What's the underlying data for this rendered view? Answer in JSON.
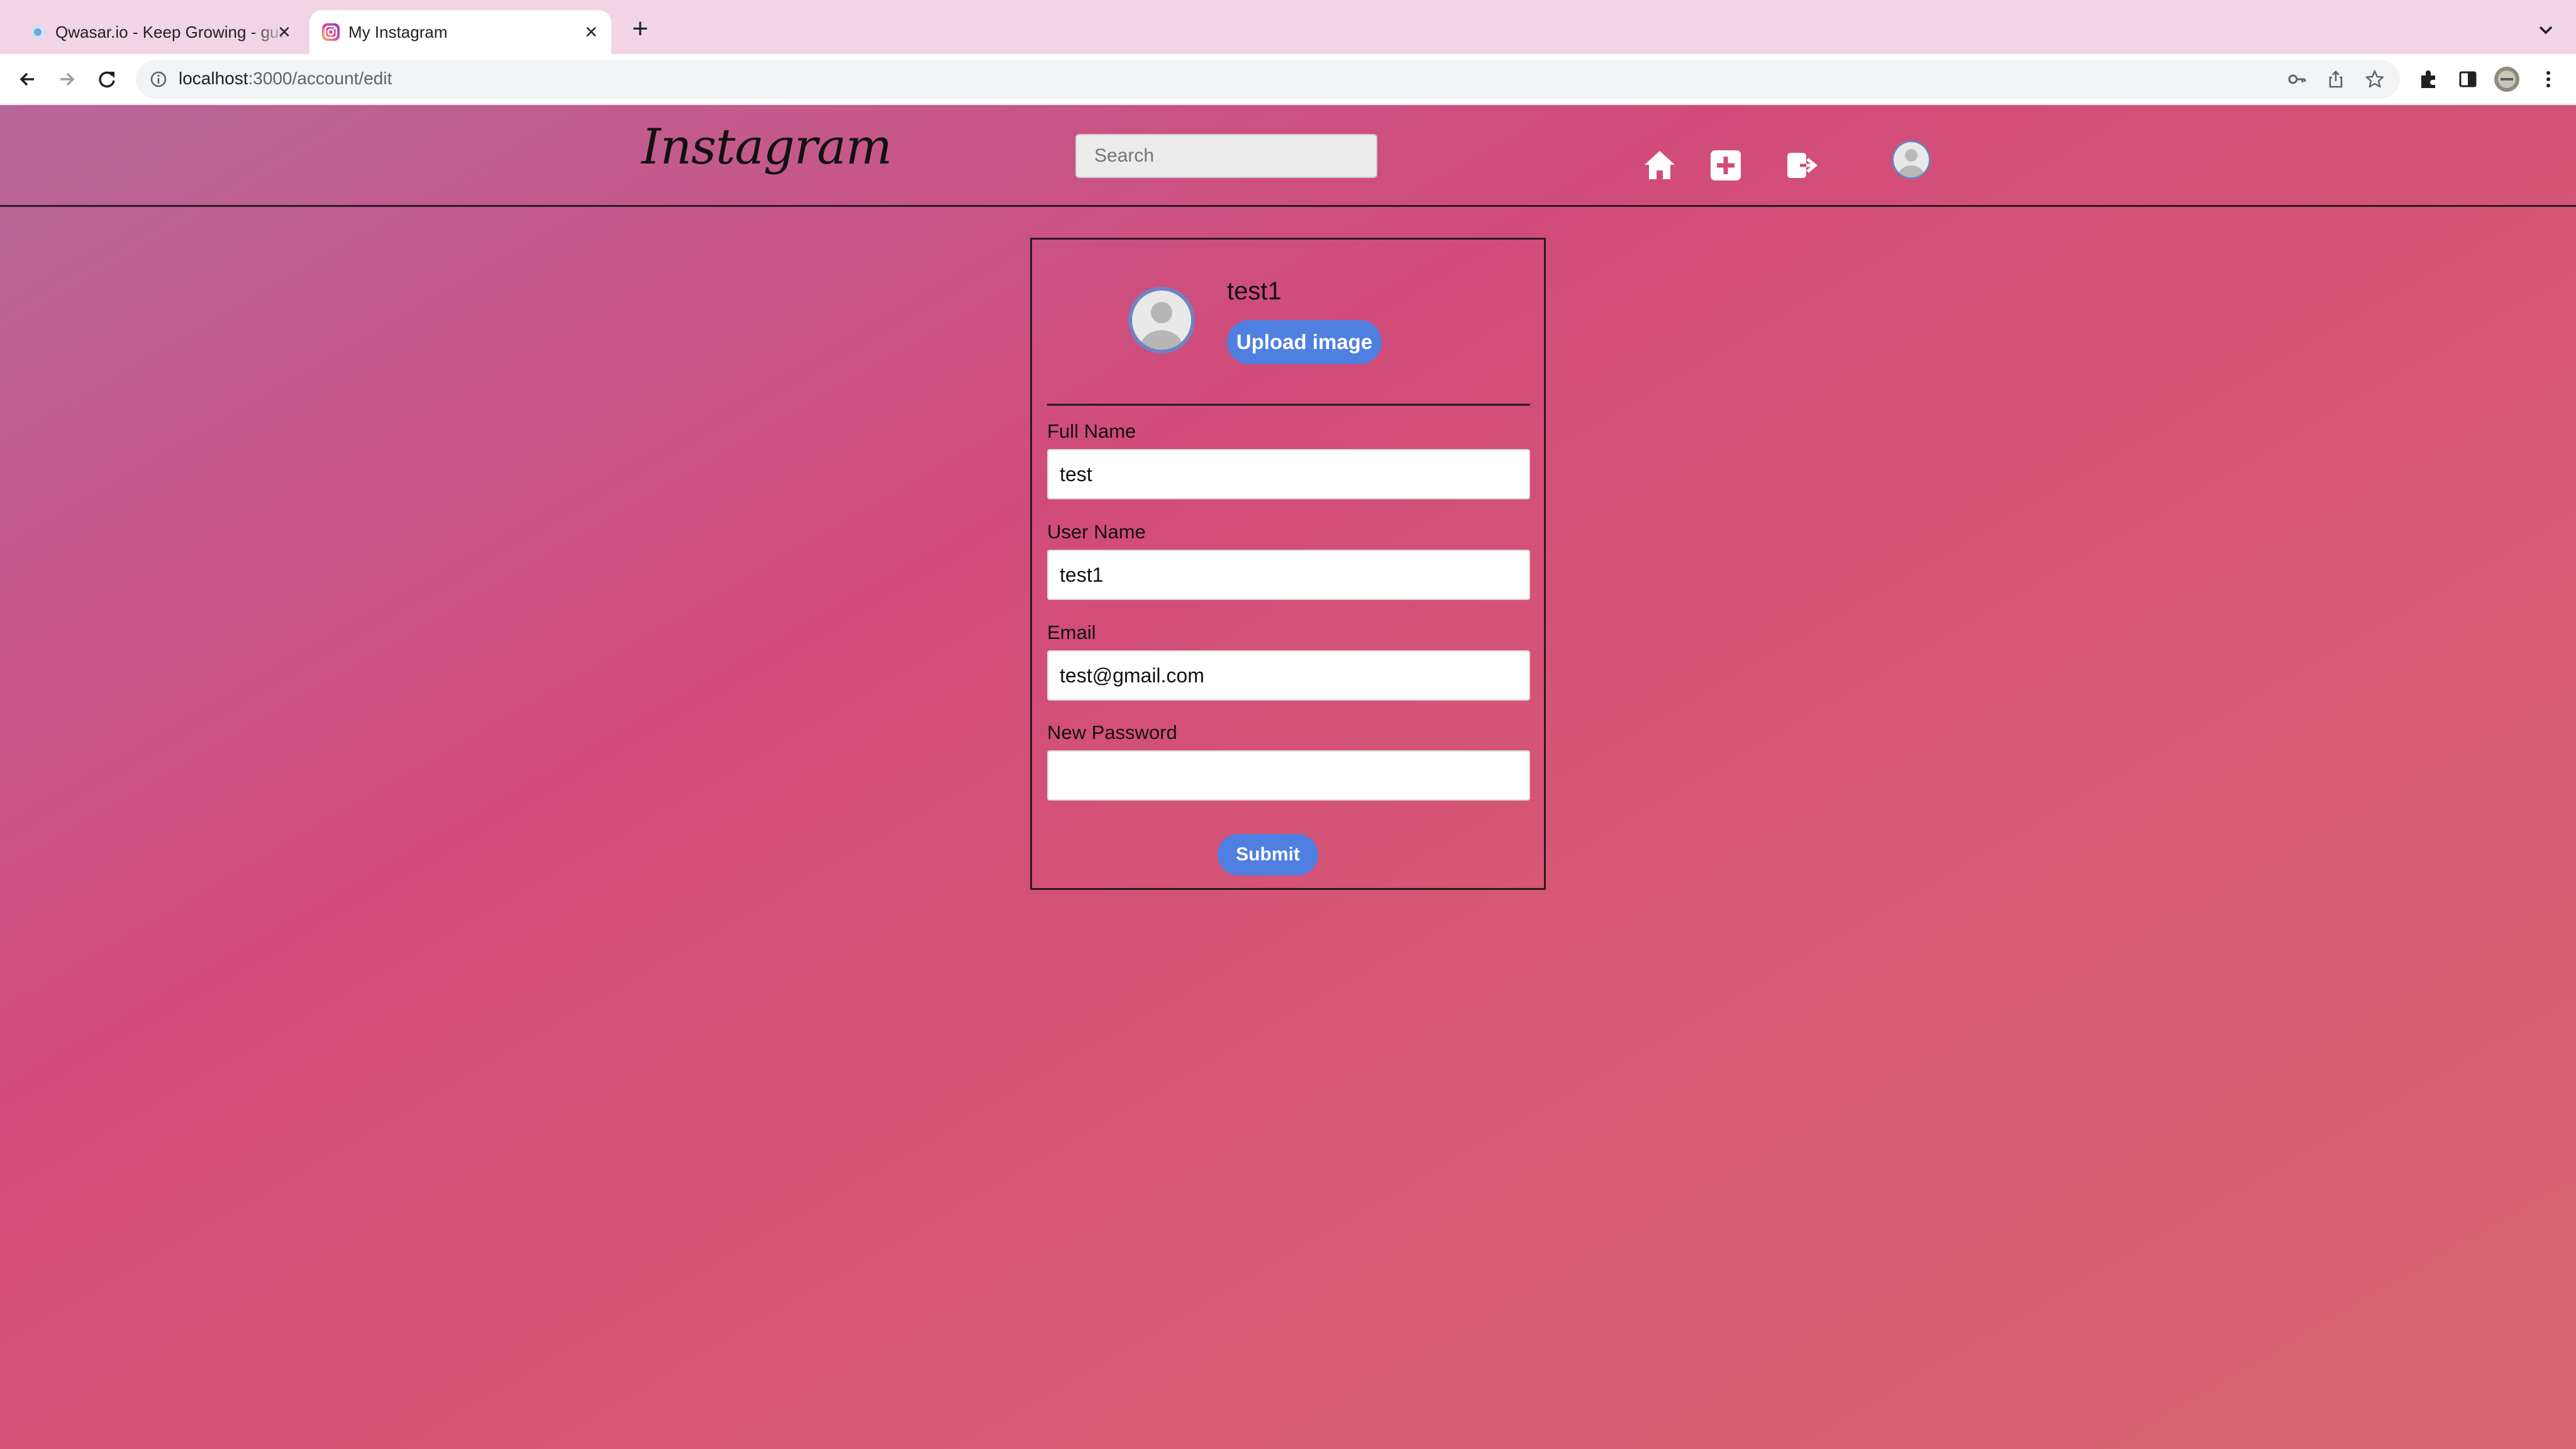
{
  "browser": {
    "tabs": [
      {
        "title": "Qwasar.io - Keep Growing - guaranteed",
        "favicon": "qwasar-favicon-icon",
        "active": false
      },
      {
        "title": "My Instagram",
        "favicon": "instagram-favicon-icon",
        "active": true
      }
    ],
    "address": {
      "host": "localhost",
      "path": ":3000/account/edit"
    },
    "icons": [
      "back-icon",
      "forward-icon",
      "reload-icon",
      "info-icon",
      "key-icon",
      "share-icon",
      "star-icon",
      "extensions-icon",
      "side-panel-icon",
      "profile-icon",
      "menu-icon"
    ]
  },
  "header": {
    "logo": "Instagram",
    "search_placeholder": "Search",
    "icons": [
      "home-icon",
      "new-post-icon",
      "logout-icon",
      "user-avatar-icon"
    ]
  },
  "profile": {
    "username": "test1",
    "upload_label": "Upload image"
  },
  "form": {
    "full_name_label": "Full Name",
    "full_name_value": "test",
    "user_name_label": "User Name",
    "user_name_value": "test1",
    "email_label": "Email",
    "email_value": "test@gmail.com",
    "password_label": "New Password",
    "password_value": "",
    "submit_label": "Submit"
  },
  "colors": {
    "tabbar_bg": "#f1d5e4",
    "page_gradient_start": "#b8679a",
    "page_gradient_mid": "#d14b7a",
    "page_gradient_end": "#d86670",
    "button_blue": "#4f7fe0"
  }
}
